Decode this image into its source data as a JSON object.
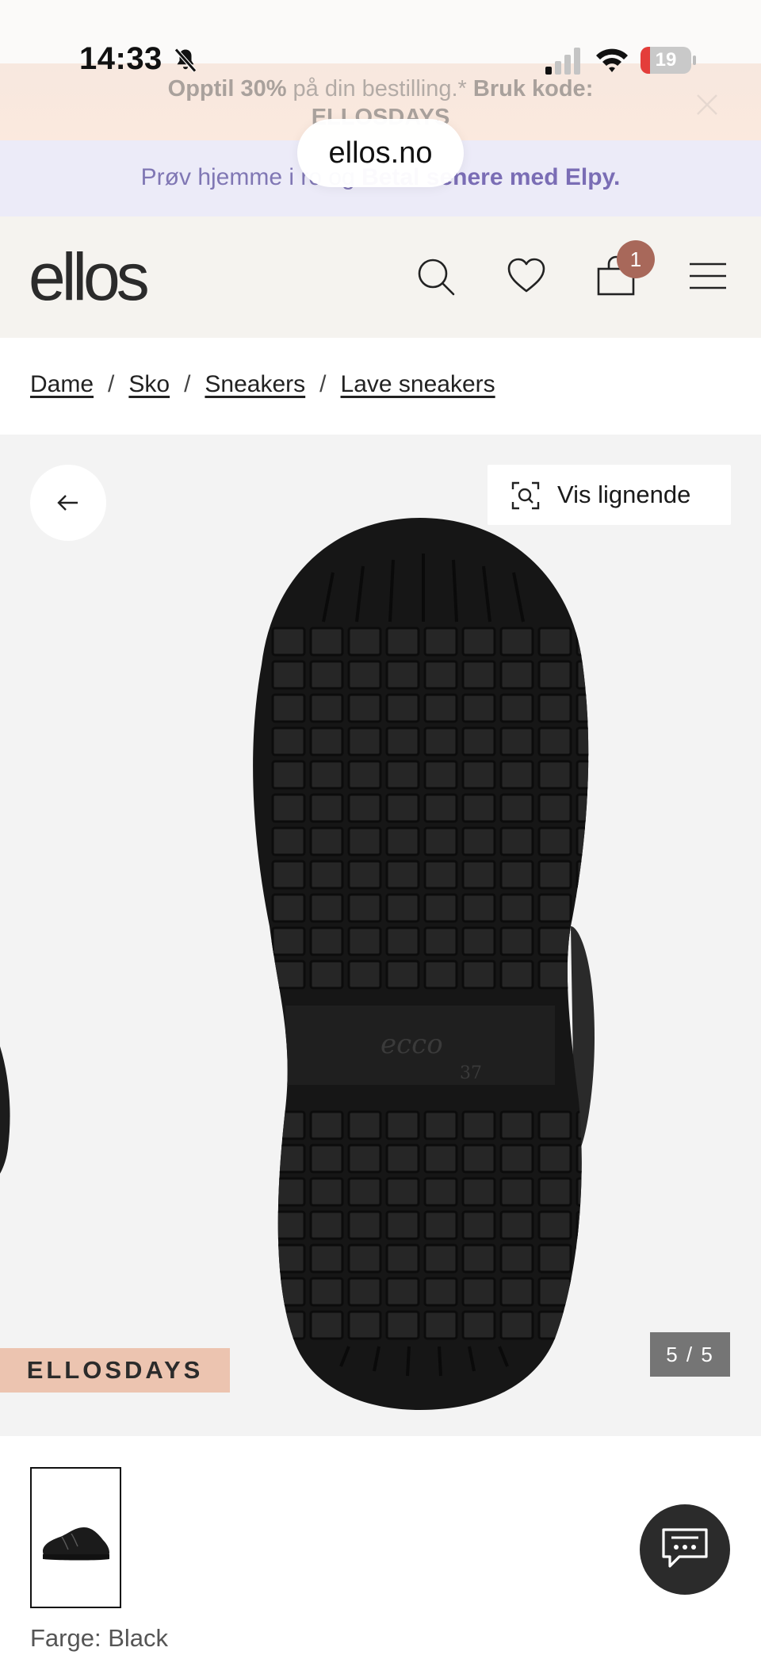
{
  "status_bar": {
    "time": "14:33",
    "battery_level": "19",
    "battery_fraction": 0.19
  },
  "promo": {
    "bold_part": "Opptil 30%",
    "middle": " på din bestilling.* ",
    "code_label": "Bruk kode:",
    "code": "ELLOSDAYS"
  },
  "elpy": {
    "prefix": "Prøv hjemme i ro og ",
    "bold_part": "Betal senere med Elpy."
  },
  "browser": {
    "url": "ellos.no"
  },
  "header": {
    "logo": "ellos",
    "cart_count": "1"
  },
  "breadcrumb": {
    "items": [
      "Dame",
      "Sko",
      "Sneakers",
      "Lave sneakers"
    ],
    "separator": "/"
  },
  "gallery": {
    "similar_label": "Vis lignende",
    "campaign_badge": "ELLOSDAYS",
    "page_counter": "5 / 5",
    "sole_brand": "ecco",
    "sole_size": "37"
  },
  "product": {
    "color_label": "Farge: Black"
  },
  "colors": {
    "badge": "#a8685a",
    "campaign": "#ecc4b0",
    "elpy": "#7a6db5",
    "header_bg": "#f5f3ef"
  },
  "icons": [
    "bell-slash-icon",
    "signal-icon",
    "wifi-icon",
    "battery-icon",
    "close-icon",
    "search-icon",
    "heart-icon",
    "bag-icon",
    "menu-icon",
    "arrow-left-icon",
    "visual-search-icon",
    "chat-icon"
  ]
}
